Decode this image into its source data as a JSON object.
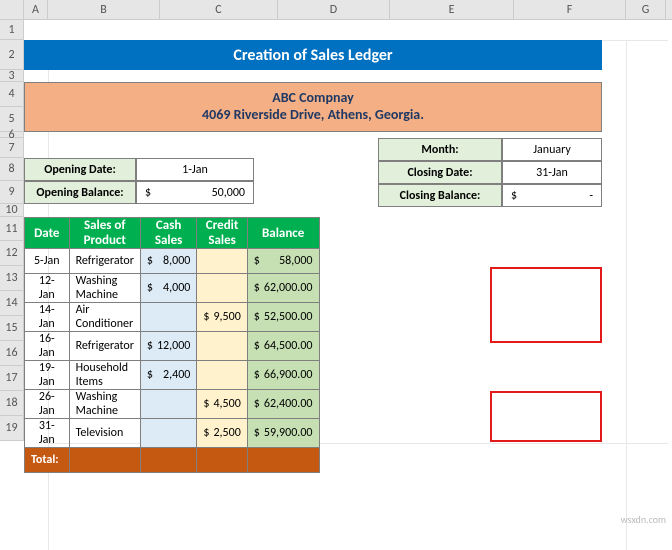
{
  "cols": [
    "A",
    "B",
    "C",
    "D",
    "E",
    "F",
    "G"
  ],
  "rows": [
    "1",
    "2",
    "3",
    "4",
    "5",
    "6",
    "7",
    "8",
    "9",
    "10",
    "11",
    "12",
    "13",
    "14",
    "15",
    "16",
    "17",
    "18",
    "19"
  ],
  "title": "Creation of Sales Ledger",
  "company": {
    "name": "ABC Compnay",
    "addr": "4069 Riverside Drive, Athens, Georgia."
  },
  "left": {
    "openDate": {
      "lbl": "Opening Date:",
      "val": "1-Jan"
    },
    "openBal": {
      "lbl": "Opening Balance:",
      "sym": "$",
      "val": "50,000"
    }
  },
  "right": {
    "month": {
      "lbl": "Month:",
      "val": "January"
    },
    "closeDate": {
      "lbl": "Closing Date:",
      "val": "31-Jan"
    },
    "closeBal": {
      "lbl": "Closing Balance:",
      "sym": "$",
      "val": "-"
    }
  },
  "headers": {
    "date": "Date",
    "prod": "Sales of Product",
    "cash": "Cash Sales",
    "credit": "Credit Sales",
    "bal": "Balance"
  },
  "tbl": [
    {
      "date": "5-Jan",
      "prod": "Refrigerator",
      "cash": "8,000",
      "credit": "",
      "bal": "58,000"
    },
    {
      "date": "12-Jan",
      "prod": "Washing Machine",
      "cash": "4,000",
      "credit": "",
      "bal": "62,000.00"
    },
    {
      "date": "14-Jan",
      "prod": "Air Conditioner",
      "cash": "",
      "credit": "9,500",
      "bal": "52,500.00"
    },
    {
      "date": "16-Jan",
      "prod": "Refrigerator",
      "cash": "12,000",
      "credit": "",
      "bal": "64,500.00"
    },
    {
      "date": "19-Jan",
      "prod": "Household Items",
      "cash": "2,400",
      "credit": "",
      "bal": "66,900.00"
    },
    {
      "date": "26-Jan",
      "prod": "Washing Machine",
      "cash": "",
      "credit": "4,500",
      "bal": "62,400.00"
    },
    {
      "date": "31-Jan",
      "prod": "Television",
      "cash": "",
      "credit": "2,500",
      "bal": "59,900.00"
    }
  ],
  "totalLabel": "Total:",
  "sym": "$",
  "watermark": "wsxdn.com",
  "chart_data": {
    "type": "table",
    "title": "Creation of Sales Ledger",
    "columns": [
      "Date",
      "Sales of Product",
      "Cash Sales",
      "Credit Sales",
      "Balance"
    ],
    "rows": [
      [
        "5-Jan",
        "Refrigerator",
        8000,
        null,
        58000
      ],
      [
        "12-Jan",
        "Washing Machine",
        4000,
        null,
        62000
      ],
      [
        "14-Jan",
        "Air Conditioner",
        null,
        9500,
        52500
      ],
      [
        "16-Jan",
        "Refrigerator",
        12000,
        null,
        64500
      ],
      [
        "19-Jan",
        "Household Items",
        2400,
        null,
        66900
      ],
      [
        "26-Jan",
        "Washing Machine",
        null,
        4500,
        62400
      ],
      [
        "31-Jan",
        "Television",
        null,
        2500,
        59900
      ]
    ],
    "opening_balance": 50000,
    "closing_balance": null
  }
}
